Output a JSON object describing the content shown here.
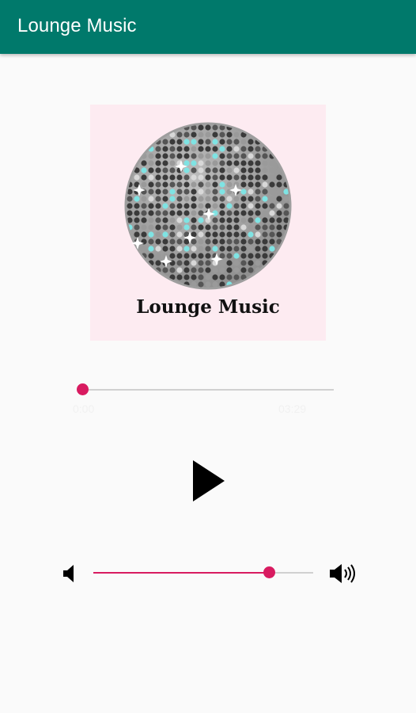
{
  "app_bar": {
    "title": "Lounge Music"
  },
  "album": {
    "caption": "Lounge Music"
  },
  "playback": {
    "elapsed": "0:00",
    "duration": "03:29",
    "progress_fraction": 0.0
  },
  "volume": {
    "level_fraction": 0.8
  },
  "icons": {
    "play": "play-icon",
    "volume_low": "volume-low-icon",
    "volume_high": "volume-high-icon"
  },
  "colors": {
    "app_bar": "#00796b",
    "accent": "#d81b60",
    "track": "#d0d0d0",
    "album_bg": "#fdebf1"
  }
}
